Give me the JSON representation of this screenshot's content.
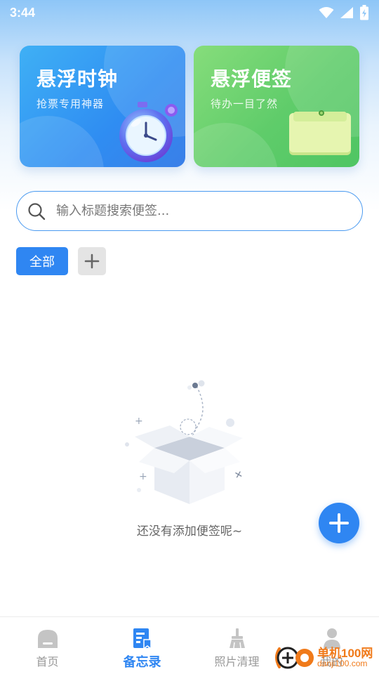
{
  "status_bar": {
    "time": "3:44",
    "icons": [
      "wifi-icon",
      "signal-icon",
      "battery-charging-icon"
    ]
  },
  "feature_cards": [
    {
      "title": "悬浮时钟",
      "subtitle": "抢票专用神器",
      "icon": "alarm-clock-icon",
      "color": "#2f8df2"
    },
    {
      "title": "悬浮便签",
      "subtitle": "待办一目了然",
      "icon": "sticky-note-icon",
      "color": "#5fcc6a"
    }
  ],
  "search": {
    "placeholder": "输入标题搜索便签...",
    "value": "",
    "icon": "search-icon"
  },
  "tags": {
    "items": [
      {
        "label": "全部",
        "selected": true
      }
    ],
    "add_icon": "plus-icon"
  },
  "empty_state": {
    "text": "还没有添加便签呢~",
    "icon": "empty-box-icon"
  },
  "fab": {
    "icon": "plus-icon"
  },
  "bottom_nav": {
    "items": [
      {
        "label": "首页",
        "icon": "home-icon",
        "active": false
      },
      {
        "label": "备忘录",
        "icon": "memo-icon",
        "active": true
      },
      {
        "label": "照片清理",
        "icon": "broom-icon",
        "active": false
      },
      {
        "label": "我的",
        "icon": "user-icon",
        "active": false
      }
    ]
  },
  "watermark": {
    "text": "单机100网",
    "url": "danji100.com"
  },
  "colors": {
    "accent": "#2f86f2",
    "clock_card": "#2f8df2",
    "note_card": "#5fcc6a",
    "watermark": "#f07a1a"
  }
}
